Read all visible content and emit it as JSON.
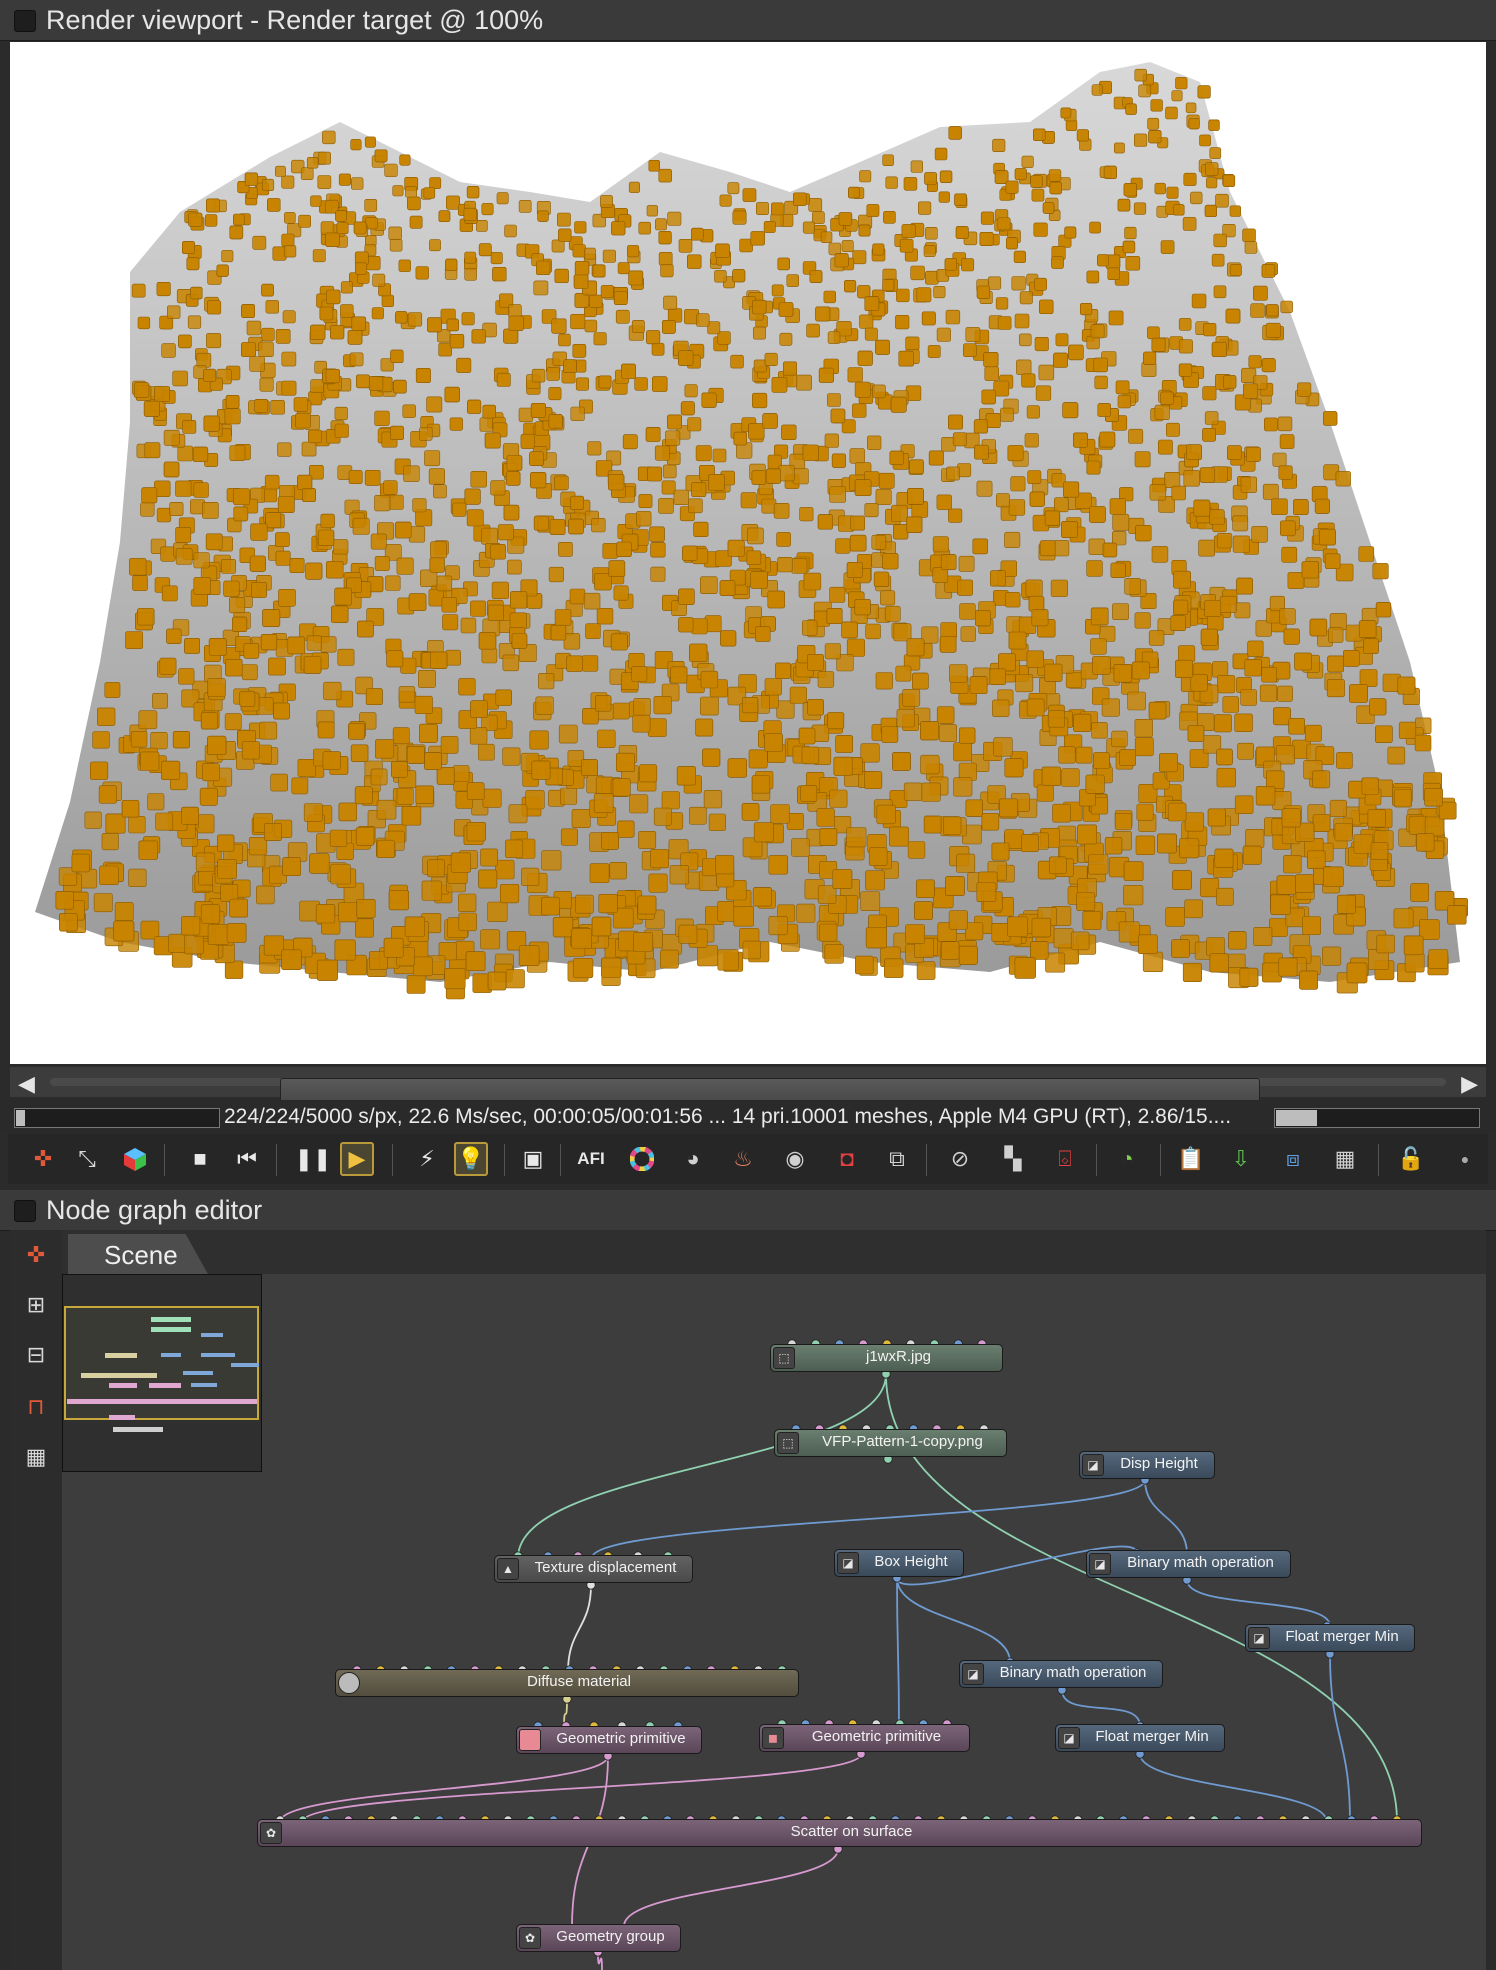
{
  "viewport": {
    "title": "Render viewport - Render target @ 100%",
    "render_description_colors": {
      "boxes": "#c88400",
      "terrain": "#b8b8b8",
      "background": "#ffffff"
    }
  },
  "status": {
    "text": "224/224/5000 s/px, 22.6 Ms/sec, 00:00:05/00:01:56 ...  14 pri.10001 meshes, Apple M4 GPU (RT), 2.86/15....",
    "progress_fraction": 0.045,
    "memory_fraction": 0.2
  },
  "toolbar": {
    "icons": [
      "recenter-view-icon",
      "zoom-region-icon",
      "color-cube-icon",
      "stop-icon",
      "restart-icon",
      "pause-icon",
      "start-icon",
      "flash-icon",
      "light-bulb-icon",
      "region-render-icon",
      "afi-icon",
      "color-wheel-icon",
      "sphere-icon",
      "paint-drop-icon",
      "camera-icon",
      "clay-icon",
      "subsampling-icon",
      "cursor-pick-icon",
      "checker-icon",
      "decal-icon",
      "speedometer-icon",
      "clipboard-icon",
      "import-icon",
      "export-icon",
      "alpha-icon",
      "lock-icon",
      "record-icon"
    ],
    "afi_label": "AFI"
  },
  "node_editor": {
    "title": "Node graph editor",
    "tab": "Scene",
    "left_icons": [
      "recenter-view-icon",
      "zoom-in-graph-icon",
      "zoom-out-graph-icon",
      "grid-snap-icon",
      "grid-icon"
    ],
    "nodes": {
      "j1wxr": "j1wxR.jpg",
      "vfp": "VFP-Pattern-1-copy.png",
      "disp_height": "Disp Height",
      "texture_displacement": "Texture displacement",
      "box_height": "Box Height",
      "binary_math_1": "Binary math operation",
      "float_merger_1": "Float merger Min",
      "binary_math_2": "Binary math operation",
      "diffuse_material": "Diffuse material",
      "geometric_primitive_1": "Geometric primitive",
      "geometric_primitive_2": "Geometric primitive",
      "float_merger_2": "Float merger Min",
      "scatter": "Scatter on surface",
      "geometry_group": "Geometry group"
    },
    "wire_colors": {
      "texture": "#8fd1b0",
      "float": "#6f9bd1",
      "material": "#d7d08e",
      "geometry": "#d79ad0"
    }
  }
}
